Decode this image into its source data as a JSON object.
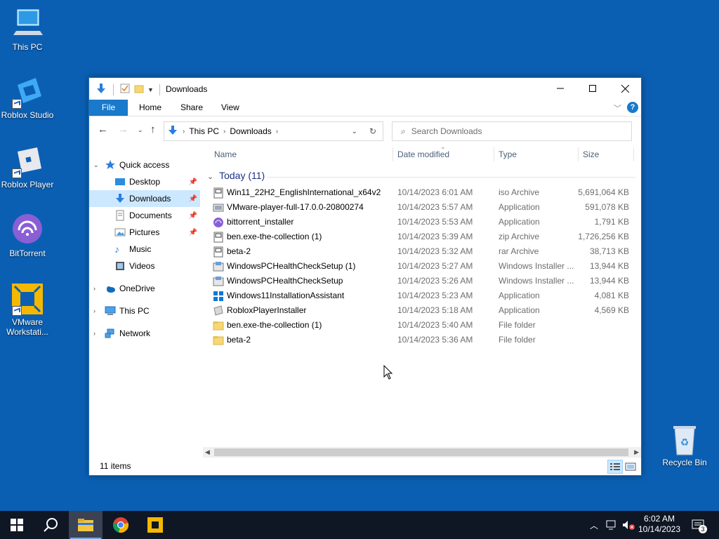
{
  "desktop": {
    "icons": [
      {
        "label": "This PC",
        "icon": "computer-icon"
      },
      {
        "label": "Roblox Studio",
        "icon": "roblox-studio-icon"
      },
      {
        "label": "Roblox Player",
        "icon": "roblox-player-icon"
      },
      {
        "label": "BitTorrent",
        "icon": "bittorrent-icon"
      },
      {
        "label": "VMware\nWorkstati...",
        "label_line1": "VMware",
        "label_line2": "Workstati...",
        "icon": "vmware-icon"
      },
      {
        "label": "Recycle Bin",
        "icon": "recycle-bin-icon"
      }
    ]
  },
  "window": {
    "title": "Downloads",
    "ribbon_tabs": [
      "File",
      "Home",
      "Share",
      "View"
    ],
    "address": {
      "segments": [
        "This PC",
        "Downloads"
      ]
    },
    "search": {
      "placeholder": "Search Downloads"
    },
    "nav": [
      {
        "label": "Quick access",
        "icon": "star-icon"
      },
      {
        "label": "Desktop",
        "icon": "desktop-icon",
        "pinned": true
      },
      {
        "label": "Downloads",
        "icon": "download-icon",
        "pinned": true,
        "selected": true
      },
      {
        "label": "Documents",
        "icon": "documents-icon",
        "pinned": true
      },
      {
        "label": "Pictures",
        "icon": "pictures-icon",
        "pinned": true
      },
      {
        "label": "Music",
        "icon": "music-icon"
      },
      {
        "label": "Videos",
        "icon": "videos-icon"
      },
      {
        "label": "OneDrive",
        "icon": "cloud-icon"
      },
      {
        "label": "This PC",
        "icon": "computer-icon"
      },
      {
        "label": "Network",
        "icon": "network-icon"
      }
    ],
    "columns": [
      "Name",
      "Date modified",
      "Type",
      "Size"
    ],
    "group": "Today (11)",
    "files": [
      {
        "name": "Win11_22H2_EnglishInternational_x64v2",
        "date": "10/14/2023 6:01 AM",
        "type": "iso Archive",
        "size": "5,691,064 KB",
        "icon": "archive-icon"
      },
      {
        "name": "VMware-player-full-17.0.0-20800274",
        "date": "10/14/2023 5:57 AM",
        "type": "Application",
        "size": "591,078 KB",
        "icon": "installer-icon"
      },
      {
        "name": "bittorrent_installer",
        "date": "10/14/2023 5:53 AM",
        "type": "Application",
        "size": "1,791 KB",
        "icon": "bittorrent-icon"
      },
      {
        "name": "ben.exe-the-collection (1)",
        "date": "10/14/2023 5:39 AM",
        "type": "zip Archive",
        "size": "1,726,256 KB",
        "icon": "archive-icon"
      },
      {
        "name": "beta-2",
        "date": "10/14/2023 5:32 AM",
        "type": "rar Archive",
        "size": "38,713 KB",
        "icon": "archive-icon"
      },
      {
        "name": "WindowsPCHealthCheckSetup (1)",
        "date": "10/14/2023 5:27 AM",
        "type": "Windows Installer ...",
        "size": "13,944 KB",
        "icon": "msi-icon"
      },
      {
        "name": "WindowsPCHealthCheckSetup",
        "date": "10/14/2023 5:26 AM",
        "type": "Windows Installer ...",
        "size": "13,944 KB",
        "icon": "msi-icon"
      },
      {
        "name": "Windows11InstallationAssistant",
        "date": "10/14/2023 5:23 AM",
        "type": "Application",
        "size": "4,081 KB",
        "icon": "windows-icon"
      },
      {
        "name": "RobloxPlayerInstaller",
        "date": "10/14/2023 5:18 AM",
        "type": "Application",
        "size": "4,569 KB",
        "icon": "roblox-icon"
      },
      {
        "name": "ben.exe-the-collection (1)",
        "date": "10/14/2023 5:40 AM",
        "type": "File folder",
        "size": "",
        "icon": "folder-icon"
      },
      {
        "name": "beta-2",
        "date": "10/14/2023 5:36 AM",
        "type": "File folder",
        "size": "",
        "icon": "folder-icon"
      }
    ],
    "status": "11 items"
  },
  "taskbar": {
    "time": "6:02 AM",
    "date": "10/14/2023",
    "notifications": "3"
  }
}
